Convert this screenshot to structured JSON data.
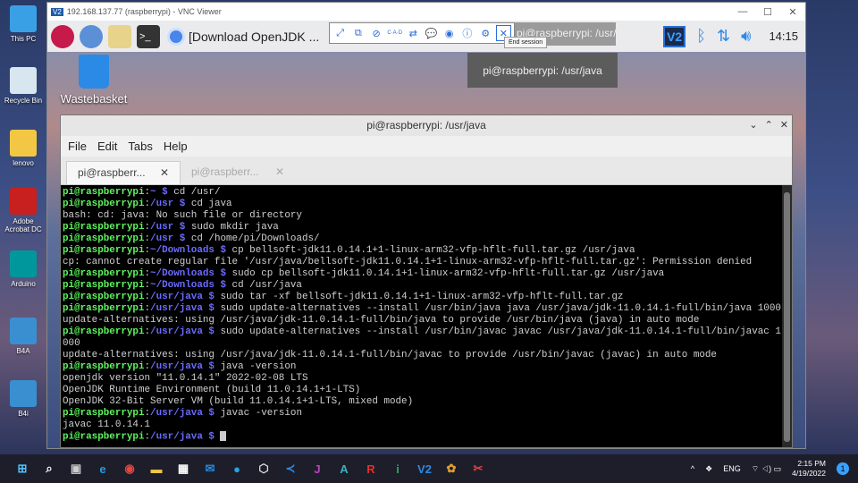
{
  "desktop": {
    "icons": [
      {
        "label": "This PC",
        "color": "#3aa0e6"
      },
      {
        "label": "Recycle Bin",
        "color": "#d8e6f0"
      },
      {
        "label": "lenovo",
        "color": "#f2c744"
      },
      {
        "label": "Adobe Acrobat DC",
        "color": "#c8201e"
      },
      {
        "label": "Arduino",
        "color": "#00979c"
      },
      {
        "label": "B4A",
        "color": "#3a8fd0"
      },
      {
        "label": "B4i",
        "color": "#3a8fd0"
      }
    ]
  },
  "vnc": {
    "title": "192.168.137.77 (raspberrypi) - VNC Viewer",
    "logo": "V2",
    "toolbar_tooltip": "End session"
  },
  "pi": {
    "taskbar": {
      "browser_item": "[Download OpenJDK ...",
      "window_tile": "pi@raspberrypi: /usr/...",
      "clock": "14:15",
      "tooltip": "pi@raspberrypi: /usr/java"
    },
    "wastebasket": "Wastebasket"
  },
  "terminal": {
    "title": "pi@raspberrypi: /usr/java",
    "menu": [
      "File",
      "Edit",
      "Tabs",
      "Help"
    ],
    "tabs": [
      "pi@raspberr...",
      "pi@raspberr..."
    ],
    "lines": [
      {
        "user": "pi@raspberrypi",
        "path": "~",
        "cmd": "cd /usr/"
      },
      {
        "user": "pi@raspberrypi",
        "path": "/usr",
        "cmd": "cd java"
      },
      {
        "out": "bash: cd: java: No such file or directory"
      },
      {
        "user": "pi@raspberrypi",
        "path": "/usr",
        "cmd": "sudo mkdir java"
      },
      {
        "user": "pi@raspberrypi",
        "path": "/usr",
        "cmd": "cd /home/pi/Downloads/"
      },
      {
        "user": "pi@raspberrypi",
        "path": "~/Downloads",
        "cmd": "cp bellsoft-jdk11.0.14.1+1-linux-arm32-vfp-hflt-full.tar.gz /usr/java"
      },
      {
        "out": "cp: cannot create regular file '/usr/java/bellsoft-jdk11.0.14.1+1-linux-arm32-vfp-hflt-full.tar.gz': Permission denied"
      },
      {
        "user": "pi@raspberrypi",
        "path": "~/Downloads",
        "cmd": "sudo cp bellsoft-jdk11.0.14.1+1-linux-arm32-vfp-hflt-full.tar.gz /usr/java"
      },
      {
        "user": "pi@raspberrypi",
        "path": "~/Downloads",
        "cmd": "cd /usr/java"
      },
      {
        "user": "pi@raspberrypi",
        "path": "/usr/java",
        "cmd": "sudo tar -xf bellsoft-jdk11.0.14.1+1-linux-arm32-vfp-hflt-full.tar.gz"
      },
      {
        "user": "pi@raspberrypi",
        "path": "/usr/java",
        "cmd": "sudo update-alternatives --install /usr/bin/java java /usr/java/jdk-11.0.14.1-full/bin/java 1000"
      },
      {
        "out": "update-alternatives: using /usr/java/jdk-11.0.14.1-full/bin/java to provide /usr/bin/java (java) in auto mode"
      },
      {
        "user": "pi@raspberrypi",
        "path": "/usr/java",
        "cmd": "sudo update-alternatives --install /usr/bin/javac javac /usr/java/jdk-11.0.14.1-full/bin/javac 1"
      },
      {
        "out": "000"
      },
      {
        "out": "update-alternatives: using /usr/java/jdk-11.0.14.1-full/bin/javac to provide /usr/bin/javac (javac) in auto mode"
      },
      {
        "user": "pi@raspberrypi",
        "path": "/usr/java",
        "cmd": "java -version"
      },
      {
        "out": "openjdk version \"11.0.14.1\" 2022-02-08 LTS"
      },
      {
        "out": "OpenJDK Runtime Environment (build 11.0.14.1+1-LTS)"
      },
      {
        "out": "OpenJDK 32-Bit Server VM (build 11.0.14.1+1-LTS, mixed mode)"
      },
      {
        "user": "pi@raspberrypi",
        "path": "/usr/java",
        "cmd": "javac -version"
      },
      {
        "out": "javac 11.0.14.1"
      },
      {
        "user": "pi@raspberrypi",
        "path": "/usr/java",
        "cmd": "",
        "cursor": true
      }
    ]
  },
  "taskbar": {
    "apps": [
      {
        "name": "start",
        "glyph": "⊞",
        "color": "#4cc2ff"
      },
      {
        "name": "search",
        "glyph": "⌕",
        "color": "#fff"
      },
      {
        "name": "task-view",
        "glyph": "▣",
        "color": "#ccc"
      },
      {
        "name": "edge",
        "glyph": "e",
        "color": "#1fa0e0"
      },
      {
        "name": "chrome",
        "glyph": "◉",
        "color": "#e8453c"
      },
      {
        "name": "file-explorer",
        "glyph": "▬",
        "color": "#f2c744"
      },
      {
        "name": "store",
        "glyph": "▦",
        "color": "#fff"
      },
      {
        "name": "mail",
        "glyph": "✉",
        "color": "#1f8ae6"
      },
      {
        "name": "app-blue",
        "glyph": "●",
        "color": "#2aa0e6"
      },
      {
        "name": "app-cube",
        "glyph": "⬡",
        "color": "#ddd"
      },
      {
        "name": "vscode",
        "glyph": "≺",
        "color": "#2a8ae6"
      },
      {
        "name": "app-j",
        "glyph": "J",
        "color": "#c040c0"
      },
      {
        "name": "app-a",
        "glyph": "A",
        "color": "#3ab0c0"
      },
      {
        "name": "app-r",
        "glyph": "R",
        "color": "#e03030"
      },
      {
        "name": "app-i",
        "glyph": "i",
        "color": "#3aa060"
      },
      {
        "name": "vnc-viewer",
        "glyph": "V2",
        "color": "#2a8ae6"
      },
      {
        "name": "paint",
        "glyph": "✿",
        "color": "#e0a030"
      },
      {
        "name": "snipping",
        "glyph": "✂",
        "color": "#e04040"
      }
    ],
    "tray": {
      "chevron": "^",
      "dropbox": "❖",
      "lang": "ENG",
      "icons": "⌔ ◁) ▭",
      "time": "2:15 PM",
      "date": "4/19/2022",
      "notifications": "1"
    }
  }
}
